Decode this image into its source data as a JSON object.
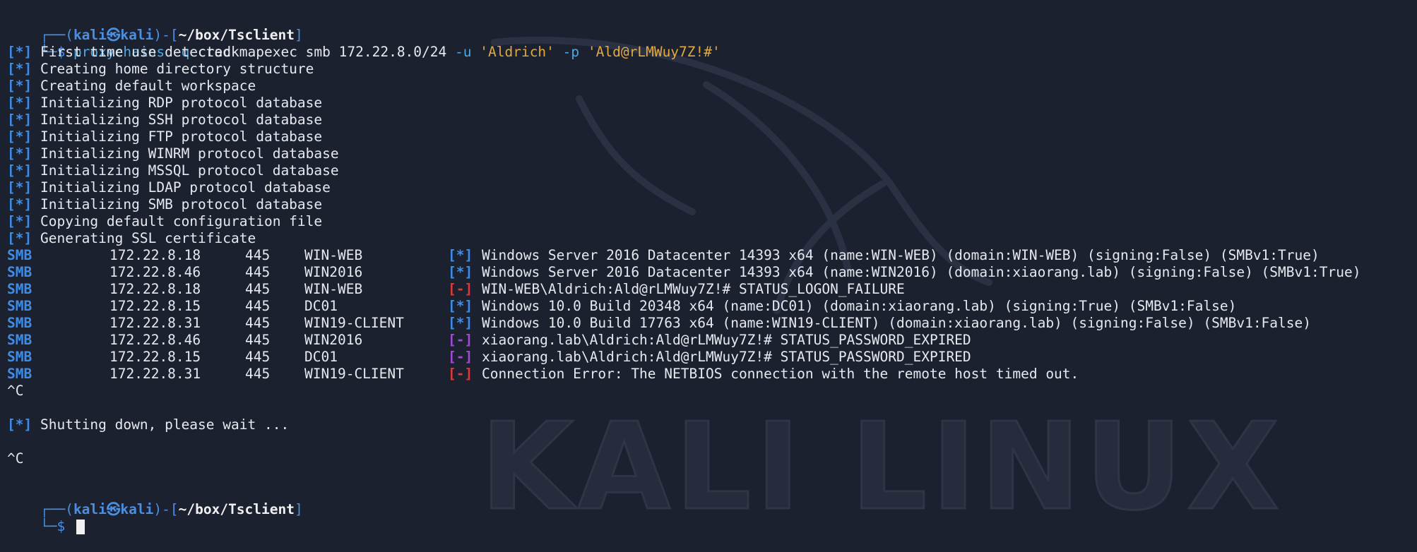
{
  "prompt1": {
    "corner": "┌──(",
    "user": "kali",
    "skull": "㉿",
    "host": "kali",
    "mid": ")-[",
    "path": "~/box/Tsclient",
    "end": "]"
  },
  "command": {
    "arrow": "└─$ ",
    "bin": "proxychains",
    "flag_q": "-q",
    "rest": "crackmapexec smb 172.22.8.0/24",
    "flag_u": "-u",
    "user": "'Aldrich'",
    "flag_p": "-p",
    "pass": "'Ald@rLMWuy7Z!#'"
  },
  "info_lines": [
    "First time use detected",
    "Creating home directory structure",
    "Creating default workspace",
    "Initializing RDP protocol database",
    "Initializing SSH protocol database",
    "Initializing FTP protocol database",
    "Initializing WINRM protocol database",
    "Initializing MSSQL protocol database",
    "Initializing LDAP protocol database",
    "Initializing SMB protocol database",
    "Copying default configuration file",
    "Generating SSL certificate"
  ],
  "info_marker": "[*]",
  "smb_rows": [
    {
      "proto": "SMB",
      "ip": "172.22.8.18",
      "port": "445",
      "host": "WIN-WEB",
      "status": "[*]",
      "msg": "Windows Server 2016 Datacenter 14393 x64 (name:WIN-WEB) (domain:WIN-WEB) (signing:False) (SMBv1:True)"
    },
    {
      "proto": "SMB",
      "ip": "172.22.8.46",
      "port": "445",
      "host": "WIN2016",
      "status": "[*]",
      "msg": "Windows Server 2016 Datacenter 14393 x64 (name:WIN2016) (domain:xiaorang.lab) (signing:False) (SMBv1:True)"
    },
    {
      "proto": "SMB",
      "ip": "172.22.8.18",
      "port": "445",
      "host": "WIN-WEB",
      "status": "[-]",
      "msg": "WIN-WEB\\Aldrich:Ald@rLMWuy7Z!# STATUS_LOGON_FAILURE"
    },
    {
      "proto": "SMB",
      "ip": "172.22.8.15",
      "port": "445",
      "host": "DC01",
      "status": "[*]",
      "msg": "Windows 10.0 Build 20348 x64 (name:DC01) (domain:xiaorang.lab) (signing:True) (SMBv1:False)"
    },
    {
      "proto": "SMB",
      "ip": "172.22.8.31",
      "port": "445",
      "host": "WIN19-CLIENT",
      "status": "[*]",
      "msg": "Windows 10.0 Build 17763 x64 (name:WIN19-CLIENT) (domain:xiaorang.lab) (signing:False) (SMBv1:False)"
    },
    {
      "proto": "SMB",
      "ip": "172.22.8.46",
      "port": "445",
      "host": "WIN2016",
      "status": "[-]",
      "msg": "xiaorang.lab\\Aldrich:Ald@rLMWuy7Z!# STATUS_PASSWORD_EXPIRED"
    },
    {
      "proto": "SMB",
      "ip": "172.22.8.15",
      "port": "445",
      "host": "DC01",
      "status": "[-]",
      "msg": "xiaorang.lab\\Aldrich:Ald@rLMWuy7Z!# STATUS_PASSWORD_EXPIRED"
    },
    {
      "proto": "SMB",
      "ip": "172.22.8.31",
      "port": "445",
      "host": "WIN19-CLIENT",
      "status": "[-]",
      "msg": "Connection Error: The NETBIOS connection with the remote host timed out."
    }
  ],
  "status_colors": [
    "blue",
    "blue",
    "red",
    "blue",
    "blue",
    "purple",
    "purple",
    "red"
  ],
  "interrupt1": "^C",
  "shutdown_marker": "[*]",
  "shutdown": "Shutting down, please wait ...",
  "interrupt2": "^C",
  "prompt2": {
    "corner": "┌──(",
    "user": "kali",
    "skull": "㉿",
    "host": "kali",
    "mid": ")-[",
    "path": "~/box/Tsclient",
    "end": "]",
    "arrow": "└─$ "
  },
  "watermark_text": "KALI LINUX",
  "colors": {
    "background": "#1c2130",
    "accent_blue": "#3d8de8",
    "string_yellow": "#e1a940",
    "error_red": "#e03838",
    "expired_purple": "#a24ad6"
  }
}
